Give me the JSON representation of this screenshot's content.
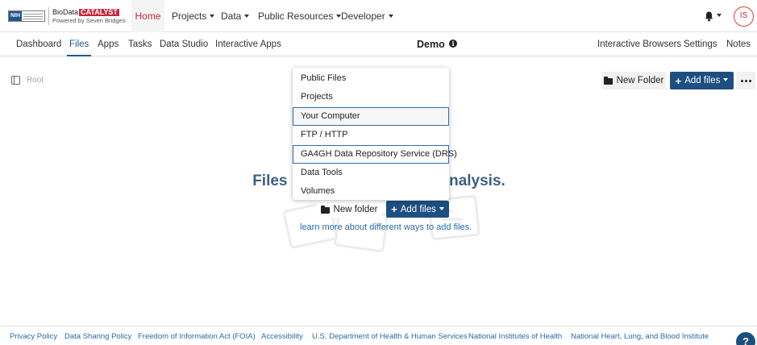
{
  "logo": {
    "badge_text": "NIH",
    "brand_prefix": "BioData",
    "brand_highlight": "CATALYST",
    "tagline": "Powered by Seven Bridges"
  },
  "topnav": {
    "items": [
      {
        "label": "Home",
        "active": true,
        "dropdown": false
      },
      {
        "label": "Projects",
        "dropdown": true
      },
      {
        "label": "Data",
        "dropdown": true
      },
      {
        "label": "Public Resources",
        "dropdown": true
      },
      {
        "label": "Developer",
        "dropdown": true
      }
    ],
    "user_initials": "IS",
    "bell_icon": "bell-icon"
  },
  "subnav": {
    "items": [
      {
        "label": "Dashboard"
      },
      {
        "label": "Files",
        "active": true
      },
      {
        "label": "Apps"
      },
      {
        "label": "Tasks"
      },
      {
        "label": "Data Studio"
      },
      {
        "label": "Interactive Apps"
      }
    ],
    "project_title": "Demo",
    "right_items": [
      {
        "label": "Interactive Browsers"
      },
      {
        "label": "Settings"
      },
      {
        "label": "Notes"
      }
    ]
  },
  "toolbar": {
    "breadcrumb_root": "Root",
    "new_folder_label": "New Folder",
    "add_files_label": "Add files"
  },
  "empty_state": {
    "title_left": "Files",
    "title_right": "analysis.",
    "new_folder_label": "New folder",
    "add_files_label": "Add files",
    "learn_more": "learn more about different ways to add files."
  },
  "add_files_menu": {
    "items": [
      {
        "label": "Public Files"
      },
      {
        "label": "Projects"
      },
      {
        "label": "Your Computer",
        "state": "hover-focus"
      },
      {
        "label": "FTP / HTTP"
      },
      {
        "label": "GA4GH Data Repository Service (DRS)",
        "state": "focus"
      },
      {
        "label": "Data Tools"
      },
      {
        "label": "Volumes"
      }
    ]
  },
  "footer": {
    "links": [
      "Privacy Policy",
      "Data Sharing Policy",
      "Freedom of Information Act (FOIA)",
      "Accessibility",
      "U.S. Department of Health & Human Services",
      "National Institutes of Health",
      "National Heart, Lung, and Blood Institute"
    ],
    "help_label": "?"
  },
  "colors": {
    "brand_red": "#c5283c",
    "primary_blue": "#1d4f80",
    "link_blue": "#2b6aa8",
    "heading_blue": "#3e5f84",
    "focus_blue": "#2f6fb3"
  }
}
